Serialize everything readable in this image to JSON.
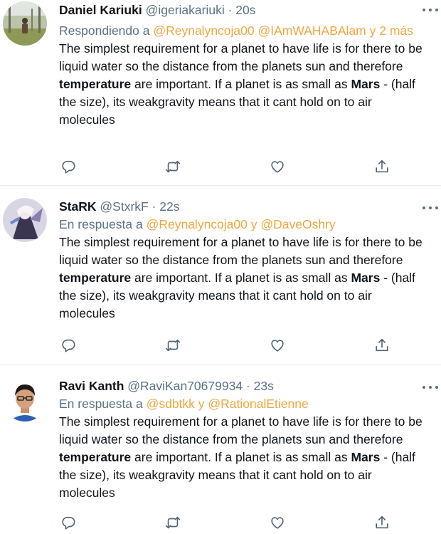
{
  "tweets": [
    {
      "name": "Daniel Kariuki",
      "handle": "@igeriakariuki",
      "sep": " · ",
      "time": "20s",
      "reply_prefix": "Respondiendo a ",
      "reply_mentions": "@Reynalyncoja00 @IAmWAHABAlam y 2 más",
      "body_1": "The simplest requirement for a planet to have life is for there to be liquid water so the distance from the planets sun and therefore ",
      "bold_1": "temperature",
      "body_2": " are important. If a planet is as small as ",
      "bold_2": "Mars",
      "body_3": " - (half the size), its weakgravity means that it cant hold on to air molecules"
    },
    {
      "name": "StaRK",
      "handle": "@StxrkF",
      "sep": " · ",
      "time": "22s",
      "reply_prefix": "En respuesta a ",
      "reply_mentions": "@Reynalyncoja00 y @DaveOshry",
      "body_1": "The simplest requirement for a planet to have life is for there to be liquid water so the distance from the planets sun and therefore ",
      "bold_1": "temperature",
      "body_2": " are important. If a planet is as small as ",
      "bold_2": "Mars",
      "body_3": " - (half the size), its weakgravity means that it cant hold on to air molecules"
    },
    {
      "name": "Ravi Kanth",
      "handle": "@RaviKan70679934",
      "sep": " · ",
      "time": "23s",
      "reply_prefix": "En respuesta a ",
      "reply_mentions": "@sdbtkk y @RationalEtienne",
      "body_1": "The simplest requirement for a planet to have life is for there to be liquid water so the distance from the planets sun and therefore ",
      "bold_1": "temperature",
      "body_2": " are important. If a planet is as small as ",
      "bold_2": "Mars",
      "body_3": " - (half the size), its weakgravity means that it cant hold on to air molecules"
    }
  ],
  "icons": {
    "reply": "reply-icon",
    "retweet": "retweet-icon",
    "like": "like-icon",
    "share": "share-icon",
    "more": "more-icon"
  },
  "colors": {
    "mention": "#f0a63e",
    "secondary_text": "#5b7083",
    "primary_text": "#0f1419",
    "divider": "#e6ecf0"
  }
}
